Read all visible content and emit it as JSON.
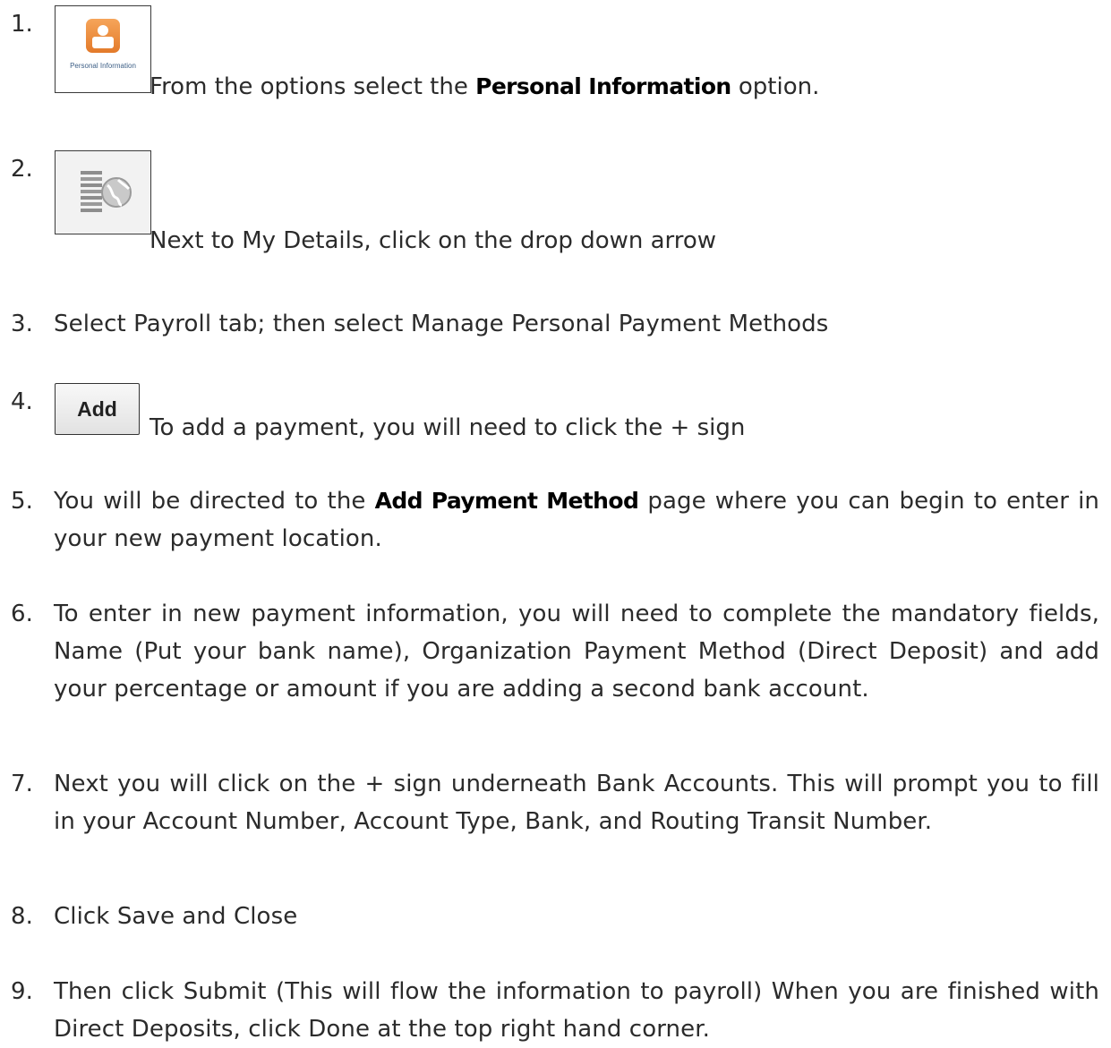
{
  "steps": [
    {
      "number": "1.",
      "icon": "personal-information-icon",
      "icon_caption": "Personal Information",
      "text_before": "From the options select the ",
      "text_bold": "Personal Information",
      "text_after": " option."
    },
    {
      "number": "2.",
      "icon": "my-details-dropdown-icon",
      "text": "Next to My Details, click on the drop down arrow"
    },
    {
      "number": "3.",
      "text": "Select Payroll tab; then select Manage Personal Payment Methods"
    },
    {
      "number": "4.",
      "button_label": "Add",
      "text": "To add a payment, you will need to click the + sign"
    },
    {
      "number": "5.",
      "text_before": "You will be directed to the ",
      "text_bold": "Add Payment Method",
      "text_after": " page where you can begin to enter in your new payment location."
    },
    {
      "number": "6.",
      "text": "To enter in new payment information, you will need to complete the mandatory fields, Name (Put your bank name), Organization Payment Method (Direct Deposit) and add your percentage or amount if you are adding a second bank account."
    },
    {
      "number": "7.",
      "text": "Next you will click on the + sign underneath Bank Accounts. This will prompt you to fill in your Account Number, Account Type, Bank, and Routing Transit Number."
    },
    {
      "number": "8.",
      "text": "Click Save and Close"
    },
    {
      "number": "9.",
      "text": "Then click Submit (This will flow the information to payroll) When you are finished with Direct Deposits, click Done at the top right hand corner."
    }
  ],
  "colors": {
    "text": "#2b2b2b",
    "bold_text": "#000000",
    "personal_icon_orange": "#e37a2a",
    "caption_blue": "#3d5f86"
  }
}
